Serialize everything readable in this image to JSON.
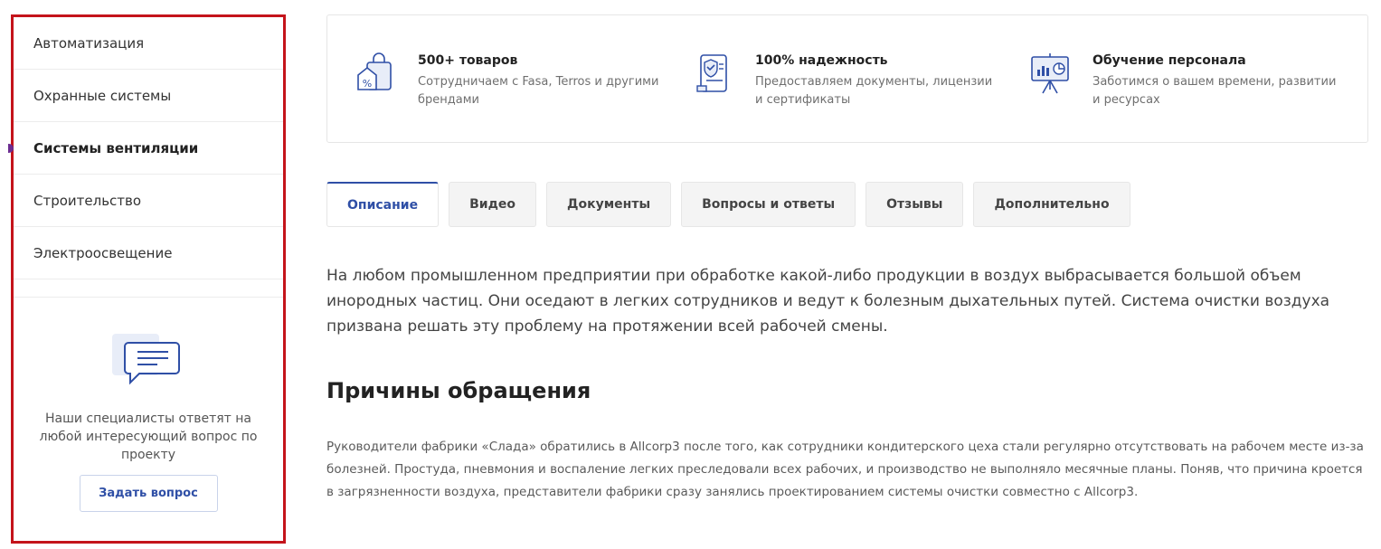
{
  "sidebar": {
    "items": [
      {
        "label": "Автоматизация"
      },
      {
        "label": "Охранные системы"
      },
      {
        "label": "Системы вентиляции"
      },
      {
        "label": "Строительство"
      },
      {
        "label": "Электроосвещение"
      }
    ],
    "help_text": "Наши специалисты ответят на любой интересующий вопрос по проекту",
    "ask_button": "Задать вопрос"
  },
  "features": [
    {
      "icon": "shopping-bag-icon",
      "title": "500+ товаров",
      "desc": "Сотрудничаем с Fasa, Terros и другими брендами"
    },
    {
      "icon": "certificate-icon",
      "title": "100% надежность",
      "desc": "Предоставляем документы, лицензии и сертификаты"
    },
    {
      "icon": "presentation-icon",
      "title": "Обучение персонала",
      "desc": "Заботимся о вашем времени, развитии и ресурсах"
    }
  ],
  "tabs": [
    {
      "label": "Описание"
    },
    {
      "label": "Видео"
    },
    {
      "label": "Документы"
    },
    {
      "label": "Вопросы и ответы"
    },
    {
      "label": "Отзывы"
    },
    {
      "label": "Дополнительно"
    }
  ],
  "content": {
    "intro": "На любом промышленном предприятии при обработке какой-либо продукции в воздух выбрасывается большой объем инородных частиц. Они оседают в легких сотрудников и ведут к болезным дыхательных путей. Система очистки воздуха призвана решать эту проблему на протяжении всей рабочей смены.",
    "heading": "Причины обращения",
    "body": "Руководители фабрики «Слада» обратились в Allcorp3 после того, как сотрудники кондитерского цеха стали регулярно отсутствовать на рабочем месте из-за болезней. Простуда, пневмония и воспаление легких преследовали всех рабочих, и производство не выполняло месячные планы. Поняв, что причина кроется в загрязненности воздуха, представители фабрики сразу занялись проектированием системы очистки совместно с Allcorp3."
  },
  "colors": {
    "accent": "#2f4fa6",
    "highlight_border": "#c4141b",
    "active_marker": "#6b2c91"
  }
}
